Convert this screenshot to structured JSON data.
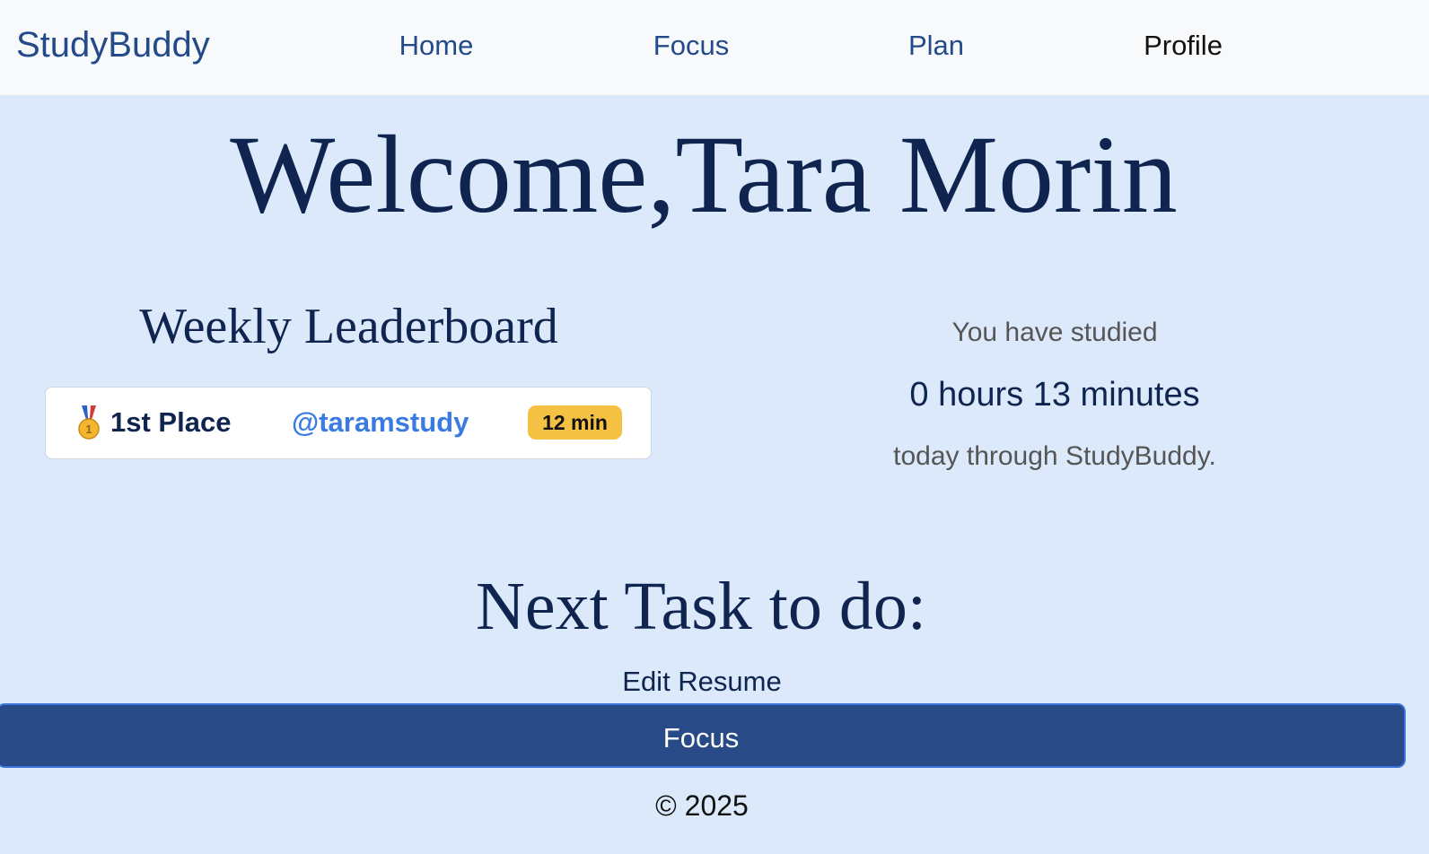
{
  "nav": {
    "brand": "StudyBuddy",
    "items": [
      {
        "label": "Home",
        "active": false
      },
      {
        "label": "Focus",
        "active": false
      },
      {
        "label": "Plan",
        "active": false
      },
      {
        "label": "Profile",
        "active": true
      }
    ]
  },
  "welcome": {
    "text": "Welcome,Tara Morin"
  },
  "leaderboard": {
    "title": "Weekly Leaderboard",
    "entries": [
      {
        "medal_icon": "gold-medal-icon",
        "place": "1st Place",
        "handle": "@taramstudy",
        "time": "12 min"
      }
    ]
  },
  "study_stats": {
    "prefix": "You have studied",
    "value": "0 hours 13 minutes",
    "suffix": "today through StudyBuddy."
  },
  "next_task": {
    "title": "Next Task to do:",
    "task_name": "Edit Resume",
    "button_label": "Focus"
  },
  "footer": {
    "text": "© 2025"
  },
  "colors": {
    "background": "#dbe9fb",
    "navbar": "#f8f9fb",
    "primary": "#234a8a",
    "heading": "#0f2550",
    "link": "#3a7be3",
    "badge": "#f4c142",
    "button": "#284b87"
  }
}
